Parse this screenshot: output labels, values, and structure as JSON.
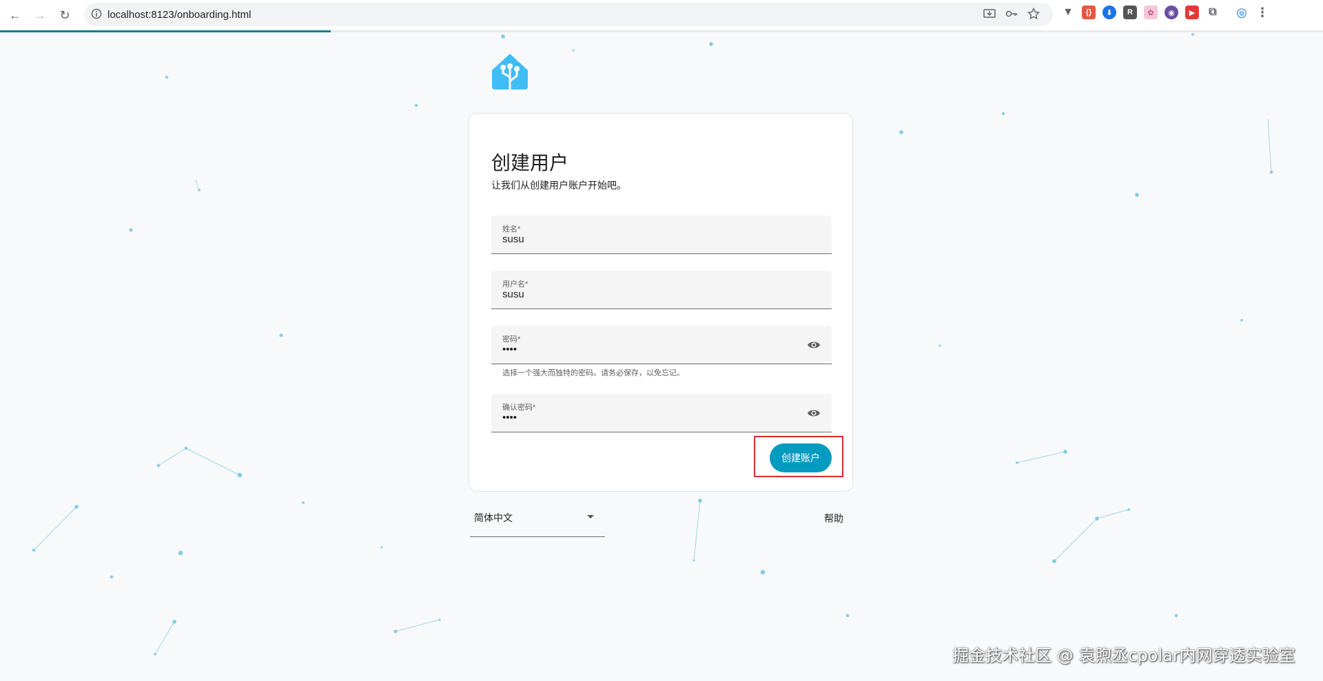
{
  "browser": {
    "url": "localhost:8123/onboarding.html",
    "load_progress": 0.25
  },
  "card": {
    "title": "创建用户",
    "subtitle": "让我们从创建用户账户开始吧。",
    "fields": {
      "name": {
        "label": "姓名*",
        "value": "susu"
      },
      "username": {
        "label": "用户名*",
        "value": "susu"
      },
      "password": {
        "label": "密码*",
        "value": "••••",
        "hint": "选择一个强大而独特的密码。请务必保存，以免忘记。"
      },
      "confirm_password": {
        "label": "确认密码*",
        "value": "••••"
      }
    },
    "create_button": "创建账户"
  },
  "footer": {
    "language": "简体中文",
    "help": "帮助"
  },
  "watermark": "掘金技术社区 @ 袁煦丞cpolar内网穿透实验室",
  "colors": {
    "accent": "#039bbf",
    "highlight": "#d32f2f",
    "logo": "#41bdf5"
  }
}
